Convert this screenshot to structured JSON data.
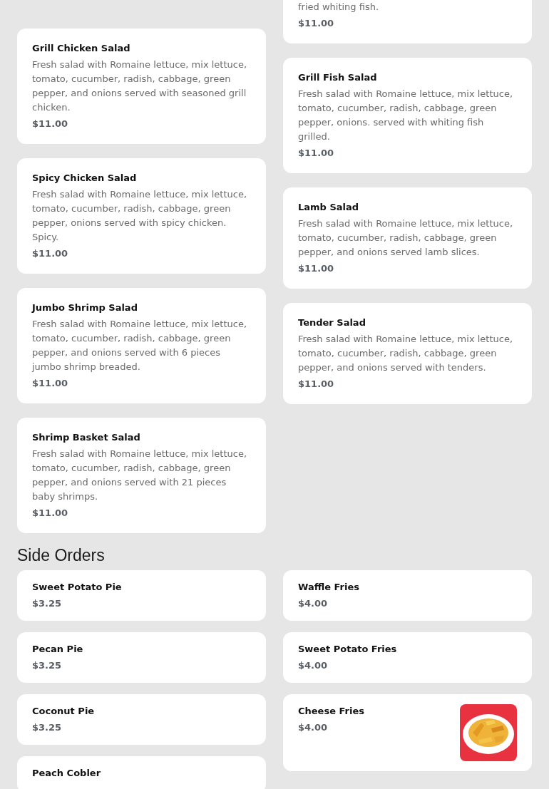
{
  "menu_sections": [
    {
      "left_column": [
        {
          "name": "Grill Chicken Salad",
          "description": "Fresh salad with Romaine lettuce, mix lettuce, tomato, cucumber, radish, cabbage, green pepper, and onions served with seasoned grill chicken.",
          "price": "$11.00"
        },
        {
          "name": "Spicy Chicken Salad",
          "description": "Fresh salad with Romaine lettuce, mix lettuce, tomato, cucumber, radish, cabbage, green pepper, onions served with spicy chicken. Spicy.",
          "price": "$11.00"
        },
        {
          "name": "Jumbo Shrimp Salad",
          "description": "Fresh salad with Romaine lettuce, mix lettuce, tomato, cucumber, radish, cabbage, green pepper, and onions served with 6 pieces jumbo shrimp breaded.",
          "price": "$11.00"
        },
        {
          "name": "Shrimp Basket Salad",
          "description": "Fresh salad with Romaine lettuce, mix lettuce, tomato, cucumber, radish, cabbage, green pepper, and onions served with 21 pieces baby shrimps.",
          "price": "$11.00"
        }
      ],
      "right_column": [
        {
          "description": "fried whiting fish.",
          "price": "$11.00"
        },
        {
          "name": "Grill Fish Salad",
          "description": "Fresh salad with Romaine lettuce, mix lettuce, tomato, cucumber, radish, cabbage, green pepper, onions. served with whiting fish grilled.",
          "price": "$11.00"
        },
        {
          "name": "Lamb Salad",
          "description": "Fresh salad with Romaine lettuce, mix lettuce, tomato, cucumber, radish, cabbage, green pepper, and onions served lamb slices.",
          "price": "$11.00"
        },
        {
          "name": "Tender Salad",
          "description": "Fresh salad with Romaine lettuce, mix lettuce, tomato, cucumber, radish, cabbage, green pepper, and onions served with tenders.",
          "price": "$11.00"
        }
      ]
    },
    {
      "title": "Side Orders",
      "left_column": [
        {
          "name": "Sweet Potato Pie",
          "price": "$3.25"
        },
        {
          "name": "Pecan Pie",
          "price": "$3.25"
        },
        {
          "name": "Coconut Pie",
          "price": "$3.25"
        },
        {
          "name": "Peach Cobler"
        }
      ],
      "right_column": [
        {
          "name": "Waffle Fries",
          "price": "$4.00"
        },
        {
          "name": "Sweet Potato Fries",
          "price": "$4.00"
        },
        {
          "name": "Cheese Fries",
          "price": "$4.00"
        }
      ]
    }
  ]
}
